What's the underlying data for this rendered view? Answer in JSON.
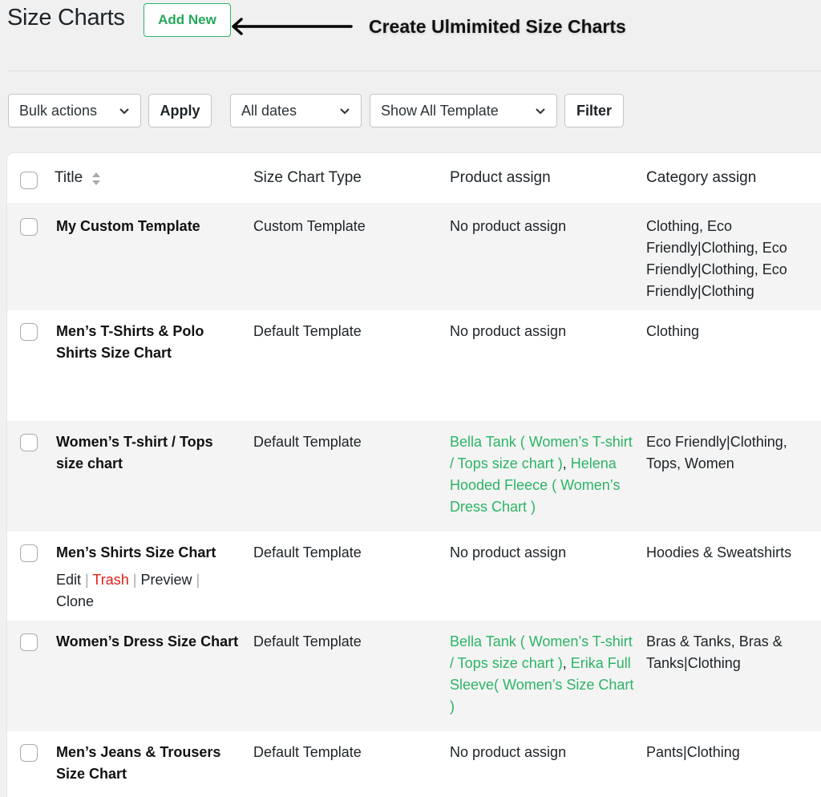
{
  "header": {
    "title": "Size Charts",
    "add_new_label": "Add New",
    "callout_text": "Create Ulmimited Size Charts"
  },
  "toolbar": {
    "bulk_actions": "Bulk actions",
    "apply_label": "Apply",
    "dates_filter": "All dates",
    "template_filter": "Show All Template",
    "filter_label": "Filter"
  },
  "table": {
    "columns": {
      "title": "Title",
      "type": "Size Chart Type",
      "product": "Product assign",
      "category": "Category assign"
    },
    "rows": [
      {
        "title": "My Custom Template",
        "type": "Custom Template",
        "product": "No product assign",
        "category": "Clothing, Eco Friendly|Clothing, Eco Friendly|Clothing, Eco Friendly|Clothing"
      },
      {
        "title": "Men’s T-Shirts & Polo Shirts Size Chart",
        "type": "Default Template",
        "product": "No product assign",
        "category": "Clothing"
      },
      {
        "title": "Women’s T-shirt / Tops size chart",
        "type": "Default Template",
        "product_links": [
          "Bella Tank ( Women’s T-shirt / Tops size chart )",
          "Helena Hooded Fleece ( Women’s Dress Chart )"
        ],
        "category": "Eco Friendly|Clothing, Tops, Women"
      },
      {
        "title": "Men’s Shirts Size Chart",
        "type": "Default Template",
        "product": "No product assign",
        "category": "Hoodies & Sweatshirts",
        "actions": {
          "edit": "Edit",
          "trash": "Trash",
          "preview": "Preview",
          "clone": "Clone",
          "separator": "|"
        }
      },
      {
        "title": "Women’s Dress Size Chart",
        "type": "Default Template",
        "product_links": [
          "Bella Tank ( Women’s T-shirt / Tops size chart )",
          "Erika Full Sleeve( Women’s Size Chart )"
        ],
        "category": "Bras & Tanks, Bras & Tanks|Clothing"
      },
      {
        "title": "Men’s Jeans & Trousers Size Chart",
        "type": "Default Template",
        "product": "No product assign",
        "category": "Pants|Clothing"
      }
    ],
    "product_separator": ","
  },
  "colors": {
    "accent_green": "#2bb465",
    "trash_red": "#e0201b",
    "page_bg": "#f0f0f1"
  }
}
